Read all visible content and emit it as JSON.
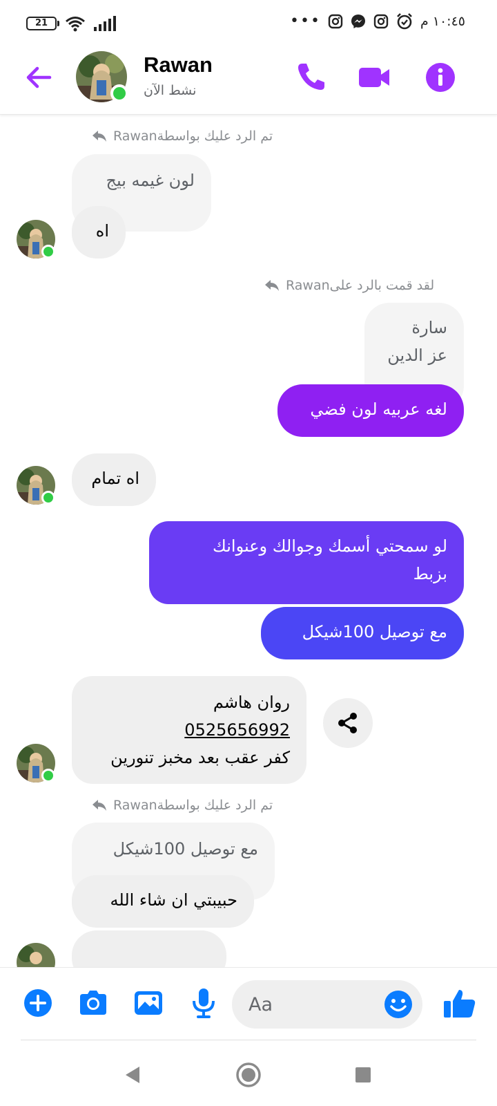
{
  "status_bar": {
    "battery": "21",
    "time": "١٠:٤٥ م"
  },
  "header": {
    "contact_name": "Rawan",
    "contact_status": "نشط الآن",
    "icons": [
      "back-arrow-icon",
      "phone-icon",
      "video-camera-icon",
      "info-icon"
    ],
    "accent_color": "#a033ff"
  },
  "messages": {
    "reply_note_1": "Rawanتم الرد عليك بواسطة",
    "quoted_1": "لون غيمه بيج",
    "in_1": "اه",
    "reply_note_2": "Rawanلقد قمت بالرد على",
    "quoted_2_line1": "سارة",
    "quoted_2_line2": "عز الدين",
    "out_1": "لغه عربيه لون فضي",
    "in_2": "اه تمام",
    "out_2_line1": "لو سمحتي أسمك وجوالك وعنوانك",
    "out_2_line2": "بزبط",
    "out_3": "مع توصيل 100شيكل",
    "contact_card_name": "روان هاشم",
    "contact_card_phone": "0525656992",
    "contact_card_address": "كفر عقب بعد مخبز تنورين",
    "reply_note_3": "Rawanتم الرد عليك بواسطة",
    "quoted_3": "مع توصيل 100شيكل",
    "in_3": "حبيبتي ان شاء الله"
  },
  "composer": {
    "placeholder": "Aa",
    "icons": [
      "plus-icon",
      "camera-icon",
      "gallery-icon",
      "microphone-icon",
      "emoji-icon",
      "thumbs-up-icon"
    ],
    "accent_color": "#0a7cff"
  }
}
